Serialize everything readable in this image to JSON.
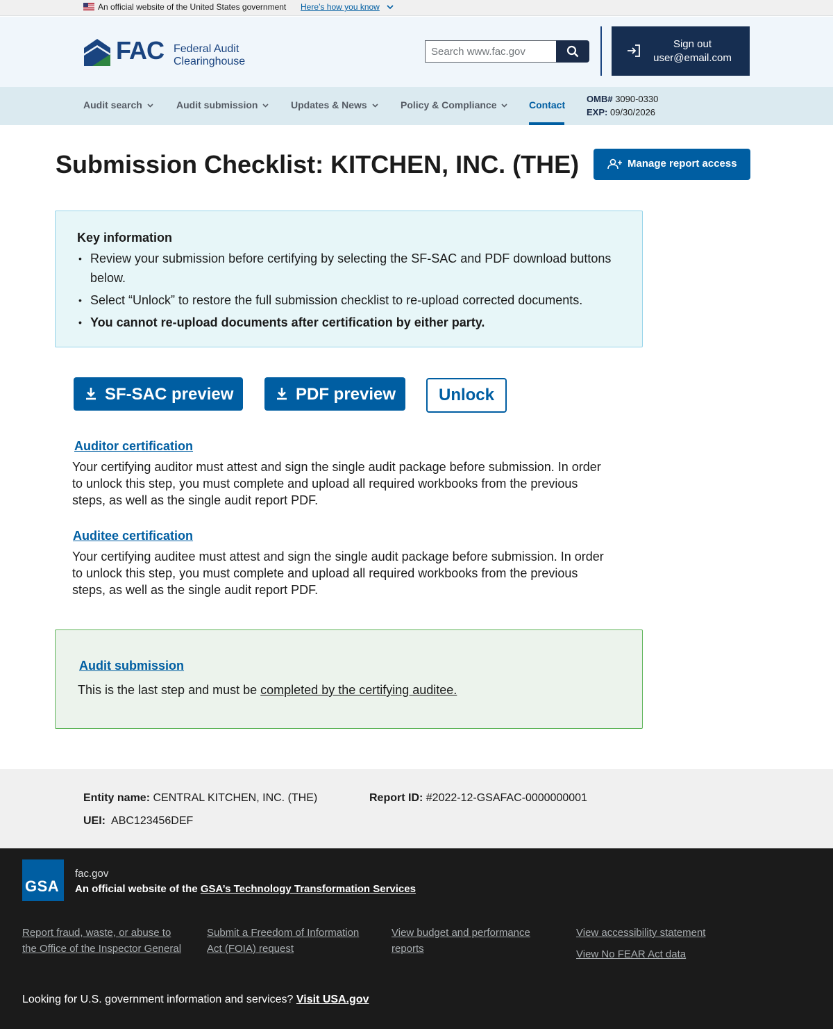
{
  "gov_banner": {
    "text": "An official website of the United States government",
    "link": "Here’s how you know"
  },
  "header": {
    "logo_word": "FAC",
    "logo_sub": "Federal Audit Clearinghouse",
    "search_placeholder": "Search www.fac.gov",
    "signout_label": "Sign out",
    "user_email": "user@email.com"
  },
  "nav": {
    "items": [
      {
        "label": "Audit search"
      },
      {
        "label": "Audit submission"
      },
      {
        "label": "Updates & News"
      },
      {
        "label": "Policy & Compliance"
      },
      {
        "label": "Contact"
      }
    ],
    "omb_label": "OMB#",
    "omb_value": "3090-0330",
    "exp_label": "EXP:",
    "exp_value": "09/30/2026"
  },
  "page": {
    "title": "Submission Checklist: KITCHEN, INC. (THE)",
    "manage_access": "Manage report access"
  },
  "key_info": {
    "title": "Key information",
    "items": [
      "Review your submission before certifying by selecting the SF-SAC and PDF download buttons below.",
      "Select “Unlock” to restore the full submission checklist to re-upload corrected documents.",
      "You cannot re-upload documents after certification by either party."
    ]
  },
  "actions": {
    "sfsac": "SF-SAC preview",
    "pdf": "PDF preview",
    "unlock": "Unlock"
  },
  "auditor_cert": {
    "link": "Auditor certification",
    "text": "Your certifying auditor must attest and sign the single audit package before submission. In order to unlock this step, you must complete and upload all required workbooks from the previous steps, as well as the single audit report PDF."
  },
  "auditee_cert": {
    "link": "Auditee certification",
    "text": "Your certifying auditee must attest and sign the single audit package before submission. In order to unlock this step, you must complete and upload all required workbooks from the previous steps, as well as the single audit report PDF."
  },
  "audit_submission": {
    "link": "Audit submission",
    "text": "This is the last step and must be ",
    "text_link": "completed by the certifying auditee."
  },
  "entity": {
    "name_label": "Entity name:",
    "name_value": "CENTRAL KITCHEN, INC. (THE)",
    "report_label": "Report ID:",
    "report_value": "#2022-12-GSAFAC-0000000001",
    "uei_label": "UEI:",
    "uei_value": "ABC123456DEF"
  },
  "footer": {
    "gsa": "GSA",
    "domain": "fac.gov",
    "official_prefix": "An official website of the ",
    "official_link": "GSA’s Technology Transformation Services",
    "links": [
      "Report fraud, waste, or abuse to the Office of the Inspector General",
      "Submit a Freedom of Information Act (FOIA) request",
      "View budget and performance reports",
      "View accessibility statement",
      "View No FEAR Act data"
    ],
    "usa_prefix": "Looking for U.S. government information and services?",
    "usa_link": "Visit USA.gov"
  },
  "colors": {
    "primary": "#005ea2",
    "navy": "#162e51",
    "info_bg": "#e7f6f8",
    "success_bg": "#ecf3ec",
    "footer_bg": "#1b1b1b"
  }
}
